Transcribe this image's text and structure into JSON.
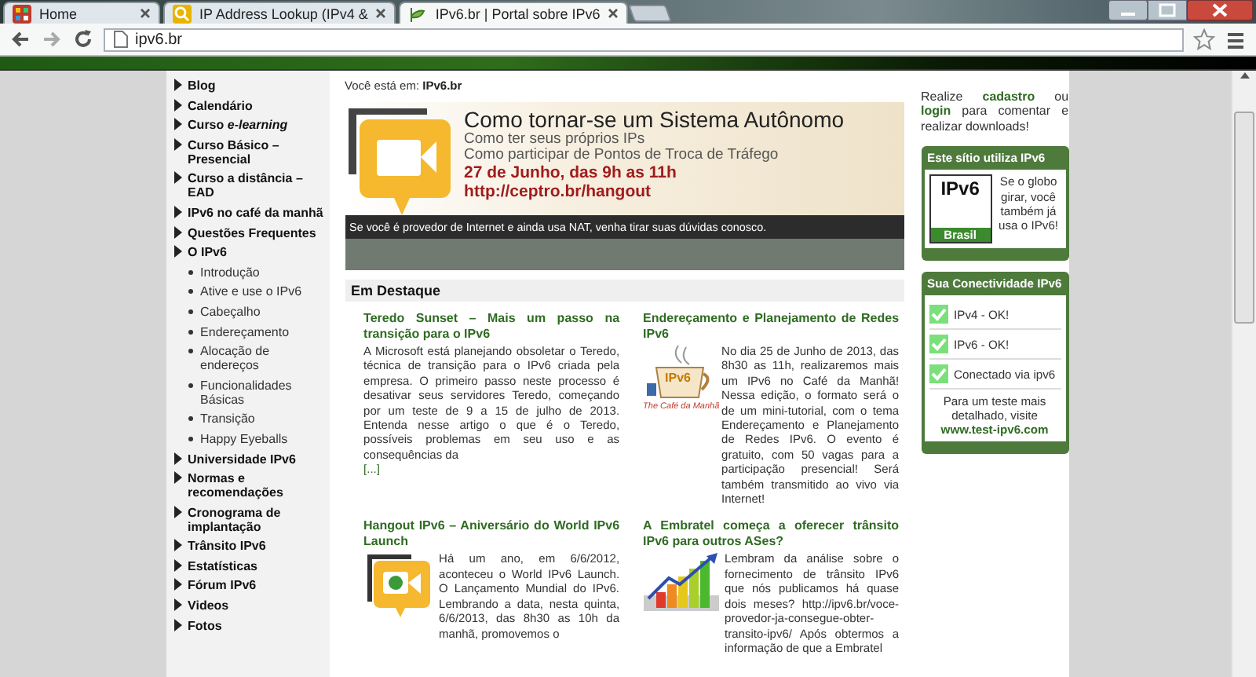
{
  "browser": {
    "tabs": [
      {
        "title": "Home",
        "selected": false
      },
      {
        "title": "IP Address Lookup (IPv4 &",
        "selected": false
      },
      {
        "title": "IPv6.br | Portal sobre IPv6",
        "selected": true
      }
    ],
    "url": "ipv6.br"
  },
  "breadcrumb": {
    "label": "Você está em:",
    "current": "IPv6.br"
  },
  "sidebar": {
    "items": [
      {
        "label": "Blog"
      },
      {
        "label": "Calendário"
      },
      {
        "label": "Curso *e-learning*"
      },
      {
        "label": "Curso Básico – Presencial"
      },
      {
        "label": "Curso a distância – EAD"
      },
      {
        "label": "IPv6 no café da manhã"
      },
      {
        "label": "Questões Frequentes"
      },
      {
        "label": "O IPv6",
        "children": [
          {
            "label": "Introdução"
          },
          {
            "label": "Ative e use o IPv6"
          },
          {
            "label": "Cabeçalho"
          },
          {
            "label": "Endereçamento"
          },
          {
            "label": "Alocação de endereços"
          },
          {
            "label": "Funcionalidades Básicas"
          },
          {
            "label": "Transição"
          },
          {
            "label": "Happy Eyeballs"
          }
        ]
      },
      {
        "label": "Universidade IPv6"
      },
      {
        "label": "Normas e recomendações"
      },
      {
        "label": "Cronograma de implantação"
      },
      {
        "label": "Trânsito IPv6"
      },
      {
        "label": "Estatísticas"
      },
      {
        "label": "Fórum IPv6"
      },
      {
        "label": "Videos"
      },
      {
        "label": "Fotos"
      }
    ]
  },
  "banner": {
    "title": "Como tornar-se um Sistema Autônomo",
    "lines": [
      "Como ter seus próprios IPs",
      "Como participar de Pontos de Troca de Tráfego"
    ],
    "date": "27 de Junho, das 9h as 11h",
    "link": "http://ceptro.br/hangout",
    "caption": "Se você é provedor de Internet e ainda usa NAT, venha tirar suas dúvidas conosco."
  },
  "featured": {
    "heading": "Em Destaque",
    "articles": [
      {
        "title": "Teredo Sunset – Mais um passo na transição para o IPv6",
        "body": "A Microsoft está planejando obsoletar o Teredo, técnica de transição para o IPv6 criada pela empresa. O primeiro passo neste processo é desativar seus servidores Teredo, começando por um teste de 9 a 15 de julho de 2013. Entenda nesse artigo o que é o Teredo, possíveis problemas em seu uso e as consequências da",
        "more": "[...]"
      },
      {
        "title": "Endereçamento e Planejamento de Redes IPv6",
        "image_text": "IPv6",
        "image_caption": "The Café da Manhã",
        "body": "No dia 25 de Junho de 2013, das 8h30 as 11h, realizaremos mais um IPv6 no Café da Manhã! Nessa edição, o formato será o de um mini-tutorial, com o tema Endereçamento e Planejamento de Redes IPv6. O evento é gratuito, com 50 vagas para a participação presencial! Será também transmitido ao vivo via Internet!"
      },
      {
        "title": "Hangout IPv6 – Aniversário do World IPv6 Launch",
        "body": "Há um ano, em 6/6/2012, aconteceu o World IPv6 Launch. O Lançamento Mundial do IPv6. Lembrando a data, nesta quinta, 6/6/2013, das 8h30 as 10h da manhã, promovemos o"
      },
      {
        "title": "A Embratel começa a oferecer trânsito IPv6 para outros ASes?",
        "body": "Lembram da análise sobre o fornecimento de trânsito IPv6 que nós publicamos há quase dois meses? http://ipv6.br/voce-provedor-ja-consegue-obter-transito-ipv6/ Após obtermos a informação de que a Embratel"
      }
    ]
  },
  "aside": {
    "prompt": [
      {
        "kind": "text",
        "text": "Realize "
      },
      {
        "kind": "link",
        "text": "cadastro"
      },
      {
        "kind": "text",
        "text": " ou "
      },
      {
        "kind": "link",
        "text": "login"
      },
      {
        "kind": "text",
        "text": " para comentar e realizar downloads!"
      }
    ],
    "badge": {
      "title": "Este sítio utiliza IPv6",
      "logo_mark": "IPv6",
      "logo_label": "Brasil",
      "text": "Se o globo girar, você também já usa o IPv6!"
    },
    "connectivity": {
      "title": "Sua Conectividade IPv6",
      "checks": [
        {
          "label": "IPv4 - OK!",
          "ok": true
        },
        {
          "label": "IPv6 - OK!",
          "ok": true
        },
        {
          "label": "Conectado via ipv6",
          "ok": true
        }
      ],
      "note": "Para um teste mais detalhado, visite",
      "link": "www.test-ipv6.com"
    }
  }
}
